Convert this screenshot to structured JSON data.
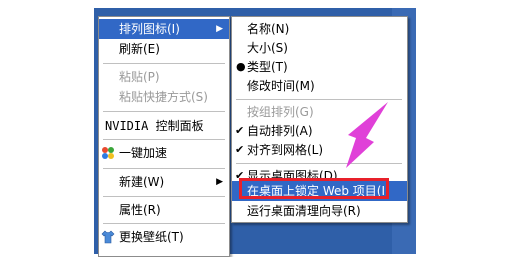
{
  "colors": {
    "menu_bg": "#ffffff",
    "highlight": "#3168c6",
    "desktop": "#2f5fa8",
    "annotation_red": "#e8202a",
    "annotation_pink": "#e040d8"
  },
  "context_menu": {
    "items": [
      {
        "label": "排列图标(I)",
        "submenu": true
      },
      {
        "label": "刷新(E)"
      },
      {
        "label": "粘贴(P)",
        "disabled": true
      },
      {
        "label": "粘贴快捷方式(S)",
        "disabled": true
      },
      {
        "label": "NVIDIA 控制面板"
      },
      {
        "label": "一键加速",
        "icon": "speedup-icon"
      },
      {
        "label": "新建(W)",
        "submenu": true
      },
      {
        "label": "属性(R)"
      },
      {
        "label": "更换壁纸(T)",
        "icon": "shirt-icon"
      }
    ]
  },
  "sub_menu": {
    "items": [
      {
        "label": "名称(N)"
      },
      {
        "label": "大小(S)"
      },
      {
        "label": "类型(T)",
        "mark": "bullet"
      },
      {
        "label": "修改时间(M)"
      },
      {
        "label": "按组排列(G)",
        "disabled": true
      },
      {
        "label": "自动排列(A)",
        "mark": "check"
      },
      {
        "label": "对齐到网格(L)",
        "mark": "check"
      },
      {
        "label": "显示桌面图标(D)",
        "mark": "check"
      },
      {
        "label": "在桌面上锁定 Web 项目(I)",
        "highlight": true
      },
      {
        "label": "运行桌面清理向导(R)"
      }
    ]
  }
}
